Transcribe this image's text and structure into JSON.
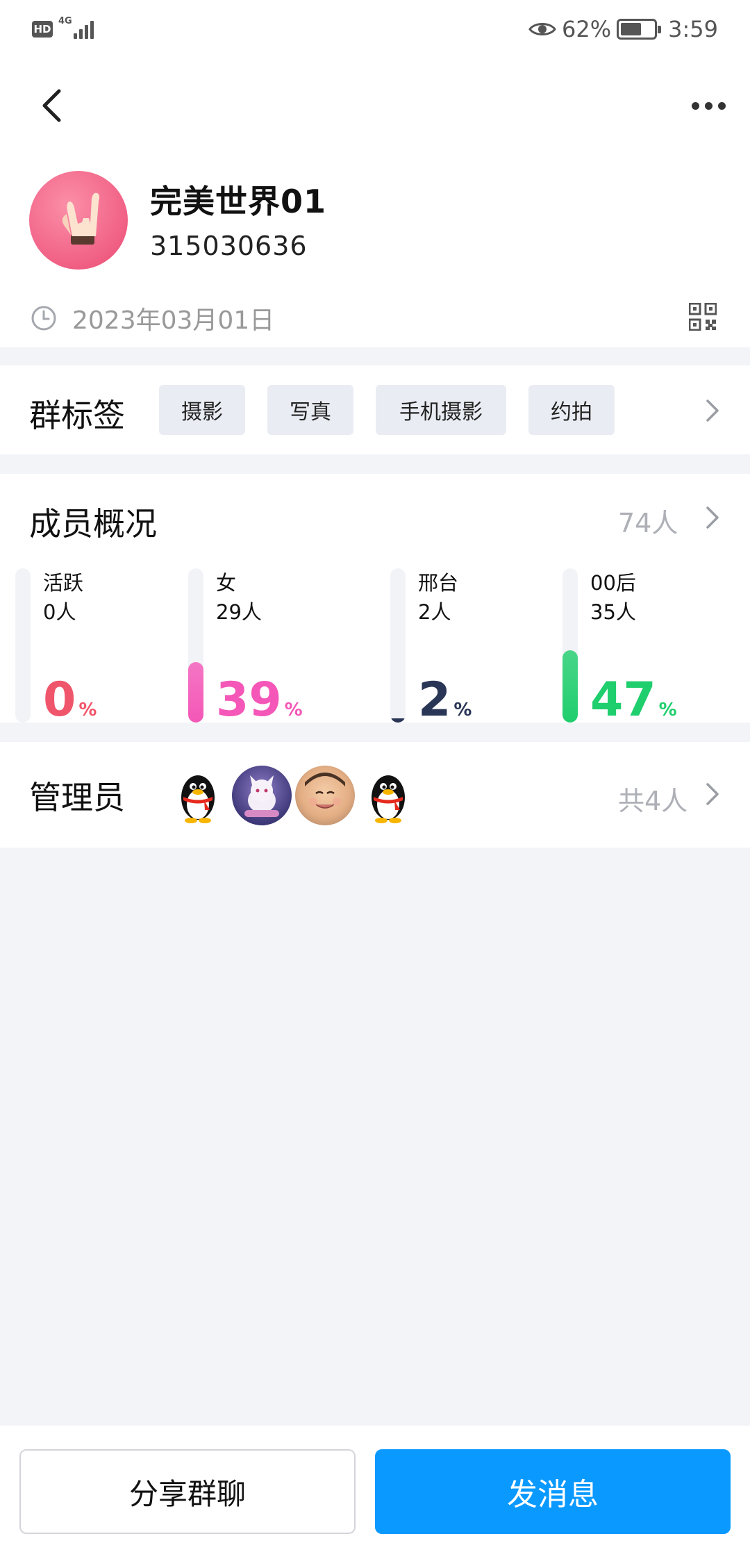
{
  "status_bar": {
    "hd": "HD",
    "network": "4G",
    "battery_percent": "62%",
    "battery_level": 0.62,
    "time": "3:59"
  },
  "group": {
    "name": "完美世界01",
    "number": "315030636",
    "created_date": "2023年03月01日"
  },
  "tags": {
    "title": "群标签",
    "items": [
      "摄影",
      "写真",
      "手机摄影",
      "约拍"
    ]
  },
  "members": {
    "title": "成员概况",
    "count": "74人",
    "stats": [
      {
        "label": "活跃",
        "count": "0人",
        "percent": "0",
        "fraction": 0.0,
        "color": "#F0566B"
      },
      {
        "label": "女",
        "count": "29人",
        "percent": "39",
        "fraction": 0.39,
        "color": "#F457B7"
      },
      {
        "label": "邢台",
        "count": "2人",
        "percent": "2",
        "fraction": 0.02,
        "color": "#2A3656"
      },
      {
        "label": "00后",
        "count": "35人",
        "percent": "47",
        "fraction": 0.47,
        "color": "#1FCE6D"
      }
    ],
    "percent_symbol": "%"
  },
  "admins": {
    "title": "管理员",
    "total": "共4人",
    "avatars": [
      "qq-penguin-avatar",
      "cartoon-cat-avatar",
      "child-photo-avatar",
      "qq-penguin-avatar"
    ]
  },
  "actions": {
    "share_label": "分享群聊",
    "send_label": "发消息"
  },
  "colors": {
    "accent": "#0A99FF",
    "background": "#F3F4F8"
  }
}
